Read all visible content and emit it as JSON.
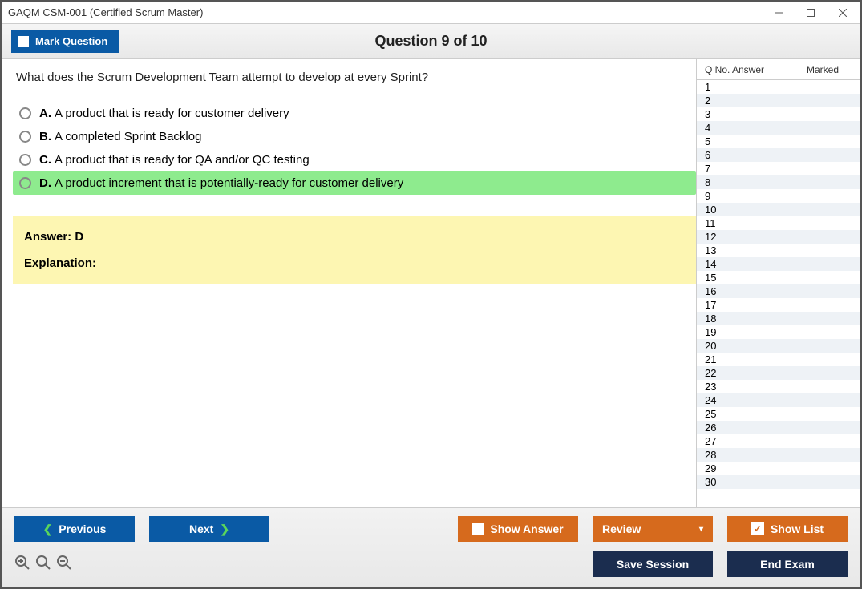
{
  "window": {
    "title": "GAQM CSM-001 (Certified Scrum Master)"
  },
  "header": {
    "mark_label": "Mark Question",
    "question_counter": "Question 9 of 10"
  },
  "question": {
    "text": "What does the Scrum Development Team attempt to develop at every Sprint?",
    "options": [
      {
        "letter": "A.",
        "text": "A product that is ready for customer delivery",
        "selected": false
      },
      {
        "letter": "B.",
        "text": "A completed Sprint Backlog",
        "selected": false
      },
      {
        "letter": "C.",
        "text": "A product that is ready for QA and/or QC testing",
        "selected": false
      },
      {
        "letter": "D.",
        "text": "A product increment that is potentially-ready for customer delivery",
        "selected": true
      }
    ],
    "answer_line": "Answer: D",
    "explanation_label": "Explanation:"
  },
  "sidepanel": {
    "header": {
      "qno": "Q No.",
      "answer": "Answer",
      "marked": "Marked"
    },
    "rows": [
      {
        "n": "1"
      },
      {
        "n": "2"
      },
      {
        "n": "3"
      },
      {
        "n": "4"
      },
      {
        "n": "5"
      },
      {
        "n": "6"
      },
      {
        "n": "7"
      },
      {
        "n": "8"
      },
      {
        "n": "9"
      },
      {
        "n": "10"
      },
      {
        "n": "11"
      },
      {
        "n": "12"
      },
      {
        "n": "13"
      },
      {
        "n": "14"
      },
      {
        "n": "15"
      },
      {
        "n": "16"
      },
      {
        "n": "17"
      },
      {
        "n": "18"
      },
      {
        "n": "19"
      },
      {
        "n": "20"
      },
      {
        "n": "21"
      },
      {
        "n": "22"
      },
      {
        "n": "23"
      },
      {
        "n": "24"
      },
      {
        "n": "25"
      },
      {
        "n": "26"
      },
      {
        "n": "27"
      },
      {
        "n": "28"
      },
      {
        "n": "29"
      },
      {
        "n": "30"
      }
    ]
  },
  "footer": {
    "previous": "Previous",
    "next": "Next",
    "show_answer": "Show Answer",
    "review": "Review",
    "show_list": "Show List",
    "save_session": "Save Session",
    "end_exam": "End Exam"
  }
}
